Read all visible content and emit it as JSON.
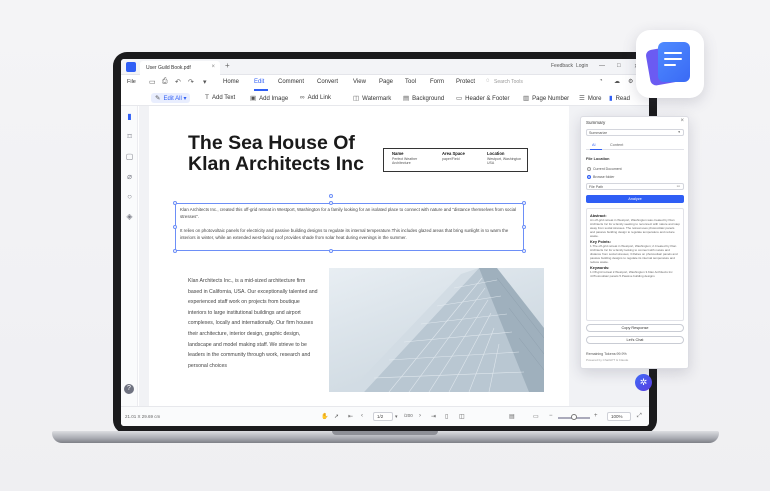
{
  "titlebar": {
    "tab_label": "User Guild Book.pdf",
    "tab_close": "×",
    "tab_add": "+",
    "feedback": "Feedback",
    "login": "Login"
  },
  "menubar": {
    "file": "File",
    "items": [
      "Home",
      "Edit",
      "Comment",
      "Convert",
      "View",
      "Page",
      "Tool",
      "Form",
      "Protect"
    ],
    "active_index": 1,
    "search_placeholder": "Search Tools"
  },
  "toolbar": {
    "edit_all": "Edit All",
    "add_text": "Add Text",
    "add_image": "Add Image",
    "add_link": "Add Link",
    "watermark": "Watermark",
    "background": "Background",
    "header_footer": "Header & Footer",
    "page_number": "Page Number",
    "more": "More",
    "read": "Read"
  },
  "document": {
    "title_line1": "The Sea House Of",
    "title_line2": "Klan Architects Inc",
    "info": [
      {
        "heading": "Name",
        "value": "Perfect Weather Architecture"
      },
      {
        "heading": "Area Space",
        "value": "paper/Field"
      },
      {
        "heading": "Location",
        "value": "Westport, Washington USA"
      }
    ],
    "selected_para1": "Klan Architects Inc., created this off-grid retreat in Westport, Washington for a family looking for an isolated place to connect with nature and \"distance themselves from social stresses\".",
    "selected_para2": "It relies on photovoltaic panels for electricity and passive building designs to regulate its internal temperature.This includes glazed areas that bring sunlight in to warm the interiors in winter, while an extended west-facing roof provides shade from solar heat during evenings in the summer.",
    "body_text": "Klan Architects Inc., is a mid-sized architecture firm based in California, USA. Our exceptionally talented and experienced staff work on projects from boutique interiors to large institutional buildings and airport complexes, locally and internationally. Our firm houses their architecture, interior design, graphic design, landscape and model making staff. We strieve to be leaders in the community through work, research and personal choices"
  },
  "statusbar": {
    "dimensions": "21.01 X 29.69 cm",
    "page_current": "1/2",
    "zoom_value": "100%"
  },
  "summary_panel": {
    "title": "Summary",
    "close": "×",
    "select_value": "Summarize",
    "tabs": [
      "AI",
      "Content"
    ],
    "active_tab": 0,
    "file_location_label": "File Location",
    "option_current": "Current Document",
    "option_browse": "Browse folder",
    "file_placeholder": "File Path",
    "analyze_button": "Analyze",
    "abstract_heading": "Abstract:",
    "abstract_text": "An off-grid retreat in Westport, Washington was created by Klan Architects Inc for a family seeking to reconnect with nature and step away from social stresses. The retreat uses photovoltaic panels and passive building design to regulate temperature and reduce waste.",
    "key_points_heading": "Key Points:",
    "key_points_text": "1.The off-grid retreat in Westport, Washington; 2.Created by Klan Architects Inc for a family looking to connect with nature and distance from social stresses; 3.Relies on photovoltaic panels and passive building designs to regulate its internal temperature and reduce waste.",
    "keywords_heading": "Keywords:",
    "keywords_text": "1.Off-grid retreat 2.Westport, Washington 3.Klan Architects Inc 4.Photovoltaic panels 5.Passive building designs",
    "copy_button": "Copy Response",
    "chat_button": "Let's Chat",
    "remaining_label": "Remaining Tokens:99.9%",
    "footnote": "Powered by ChatGPT & Claude"
  },
  "colors": {
    "accent": "#2f5ef5",
    "laptop_frame": "#1b1b1d"
  }
}
